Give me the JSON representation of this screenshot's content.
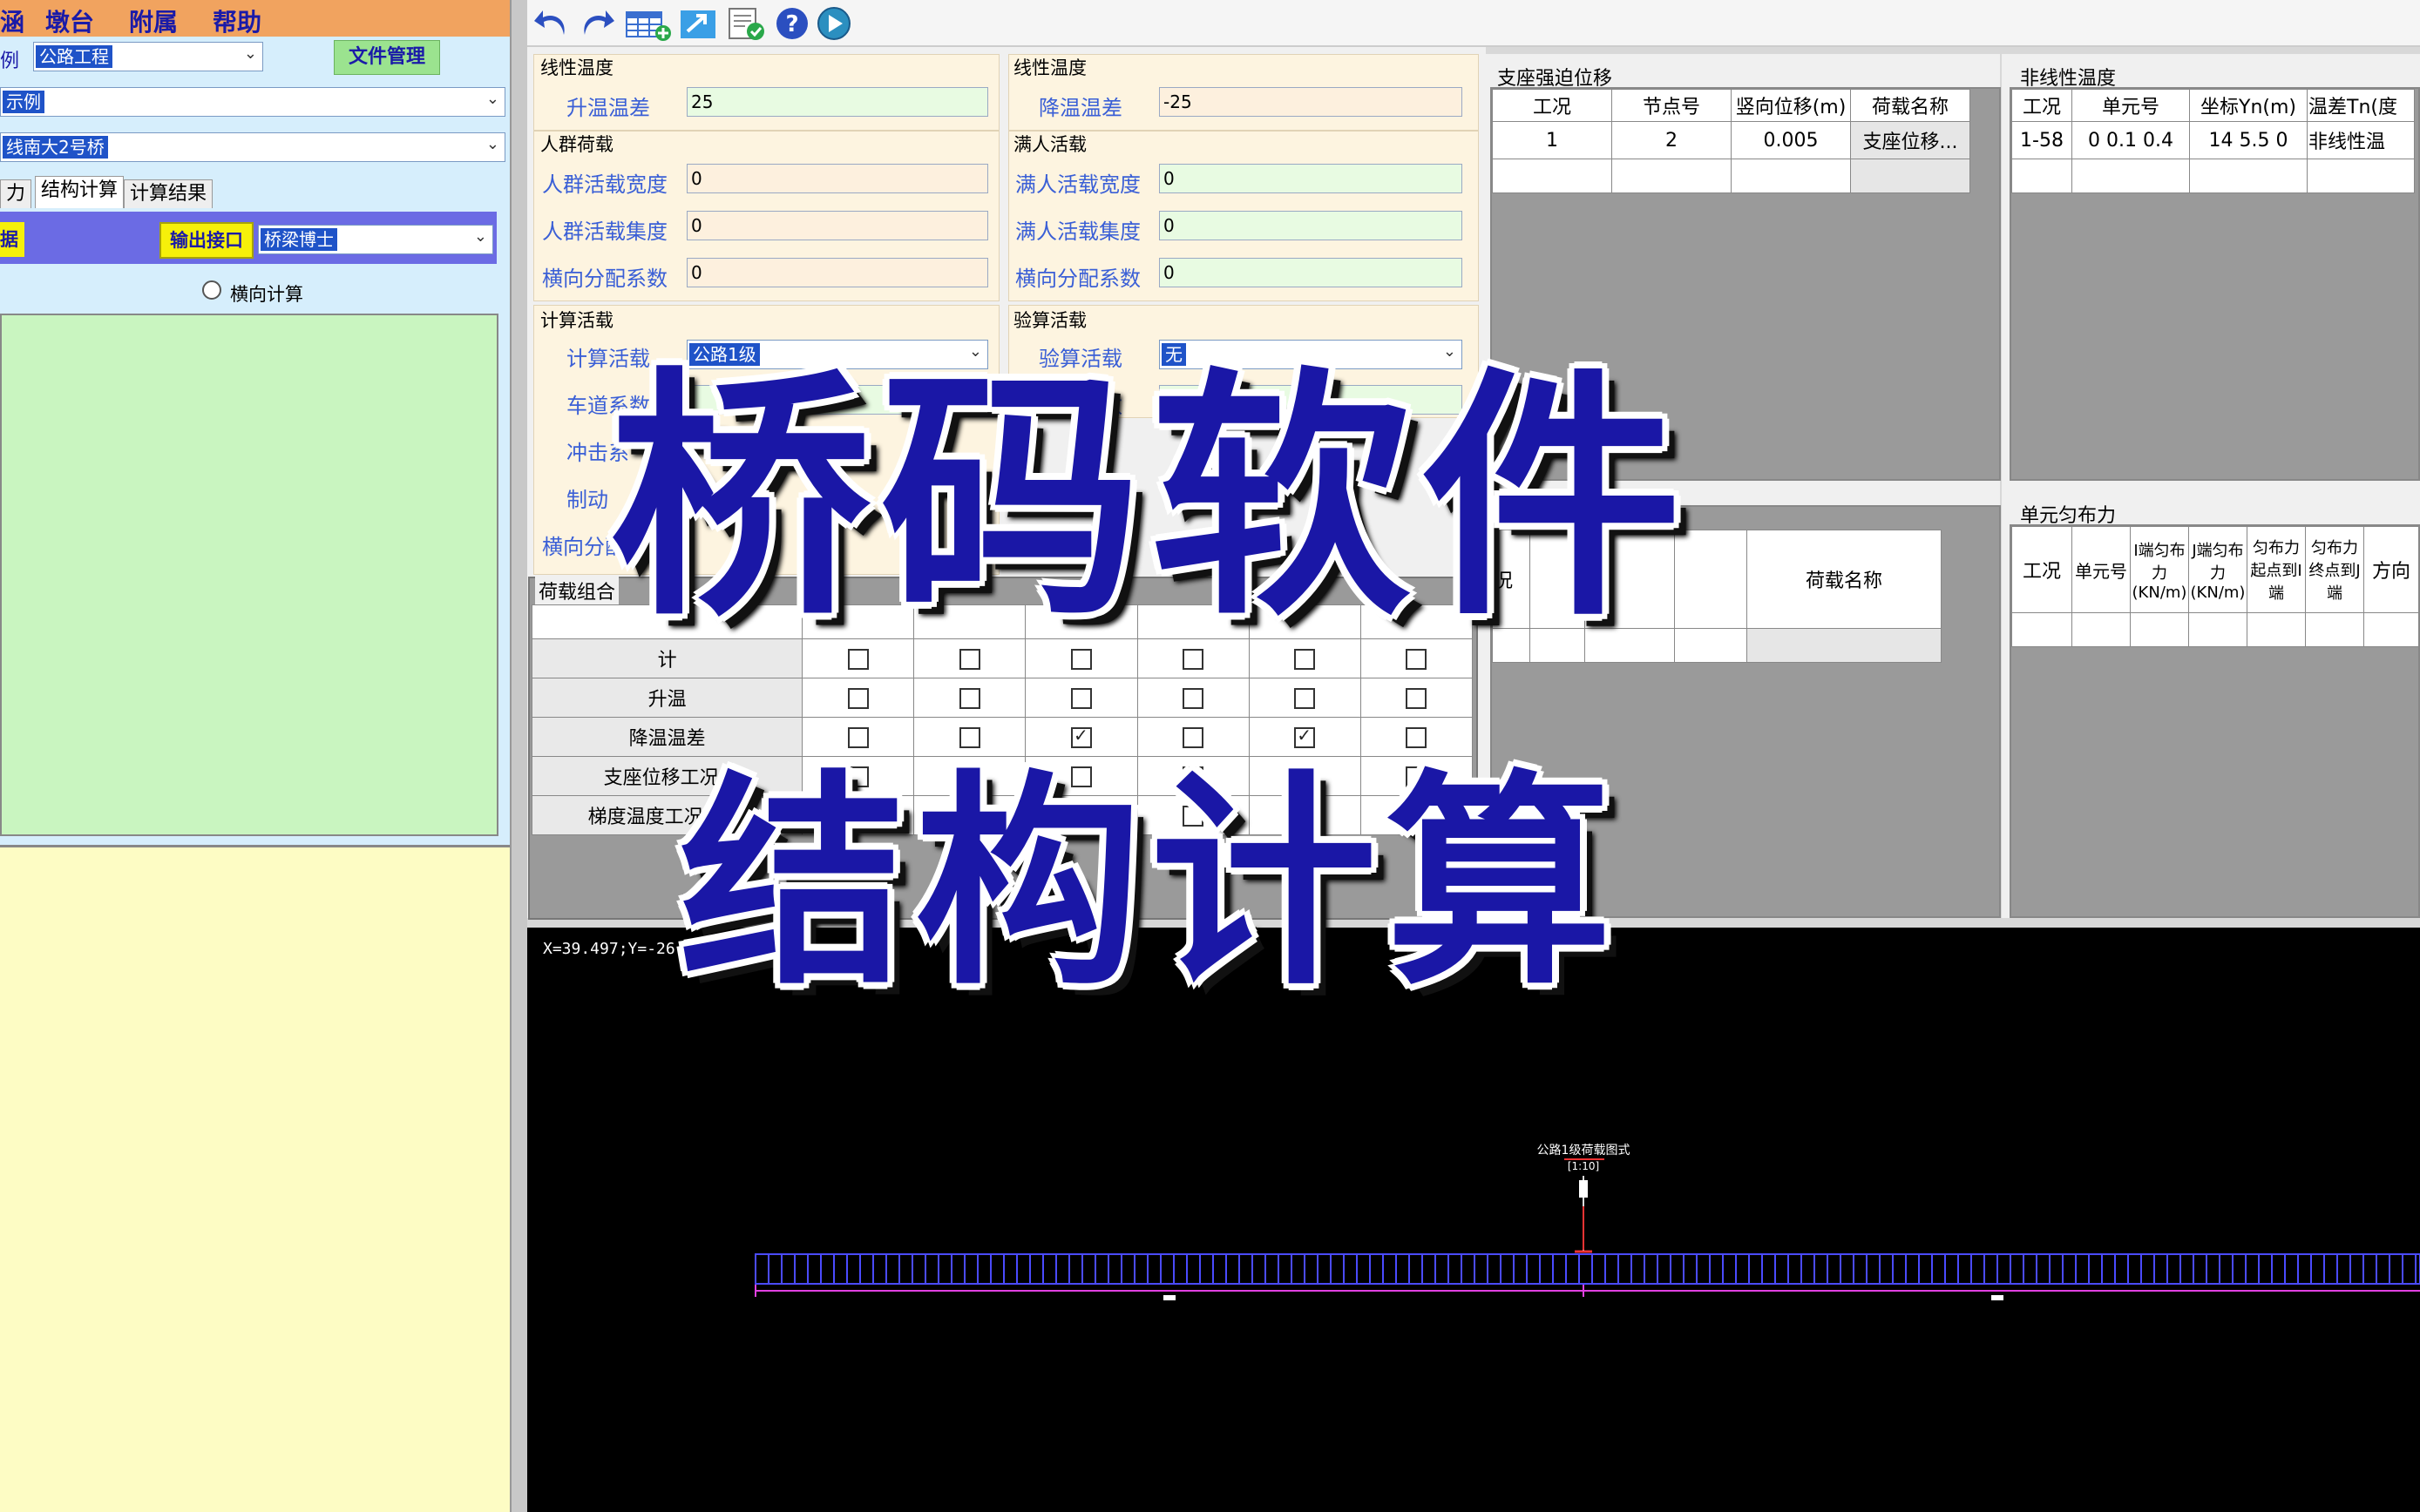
{
  "menu": [
    "涵",
    "墩台",
    "附属",
    "帮助"
  ],
  "left": {
    "row1_label": "例",
    "row1_select": "公路工程",
    "file_btn": "文件管理",
    "select2": "示例",
    "select3": "线南大2号桥",
    "tabs": [
      "力",
      "结构计算",
      "计算结果"
    ],
    "strip_label": "据",
    "output_btn": "输出接口",
    "output_select": "桥梁博士",
    "radio_label": "横向计算"
  },
  "form": {
    "g1": "线性温度",
    "g1_label": "升温温差",
    "g1_value": "25",
    "g2": "线性温度",
    "g2_label": "降温温差",
    "g2_value": "-25",
    "g3": "人群荷载",
    "g3_labels": [
      "人群活载宽度",
      "人群活载集度",
      "横向分配系数"
    ],
    "g3_values": [
      "0",
      "0",
      "0"
    ],
    "g4": "满人活载",
    "g4_labels": [
      "满人活载宽度",
      "满人活载集度",
      "横向分配系数"
    ],
    "g4_values": [
      "0",
      "0",
      "0"
    ],
    "g5": "计算活载",
    "g5_labels": [
      "计算活载",
      "车道系数",
      "冲击系",
      "制动",
      "横向分配"
    ],
    "g5_select": "公路1级",
    "g6": "验算活载",
    "g6_labels": [
      "验算活载",
      "车道系数"
    ],
    "g6_select": "无",
    "g6_value": "0"
  },
  "combo": {
    "title": "荷载组合",
    "rows": [
      {
        "name": "计",
        "checks": [
          false,
          false,
          false,
          false,
          false,
          false
        ]
      },
      {
        "name": "升温",
        "checks": [
          false,
          false,
          false,
          false,
          false,
          false
        ]
      },
      {
        "name": "降温温差",
        "checks": [
          false,
          false,
          true,
          false,
          true,
          false
        ]
      },
      {
        "name": "支座位移工况1",
        "checks": [
          false,
          false,
          false,
          false,
          false,
          false
        ]
      },
      {
        "name": "梯度温度工况1-58",
        "checks": [
          false,
          false,
          false,
          false,
          false,
          false
        ]
      }
    ]
  },
  "support": {
    "title": "支座强迫位移",
    "headers": [
      "工况",
      "节点号",
      "竖向位移(m)",
      "荷载名称"
    ],
    "row": [
      "1",
      "2",
      "0.005",
      "支座位移..."
    ]
  },
  "nonlinear": {
    "title": "非线性温度",
    "headers": [
      "工况",
      "单元号",
      "坐标Yn(m)",
      "温差Tn(度"
    ],
    "row": [
      "1-58",
      "0 0.1 0.4",
      "14 5.5 0",
      "非线性温"
    ]
  },
  "mid_table": {
    "headers": [
      "况",
      "荷载名称"
    ]
  },
  "uniform": {
    "title": "单元匀布力",
    "headers": [
      "工况",
      "单元号",
      "I端匀布力(KN/m)",
      "J端匀布力(KN/m)",
      "匀布力起点到I端",
      "匀布力终点到J端",
      "方向"
    ]
  },
  "canvas": {
    "coords": "X=39.497;Y=-26.6",
    "label_top": "公路1级荷载图式",
    "label_sub": "[1:10]"
  },
  "overlay": {
    "line1": "桥码软件",
    "line2": "结构计算"
  }
}
